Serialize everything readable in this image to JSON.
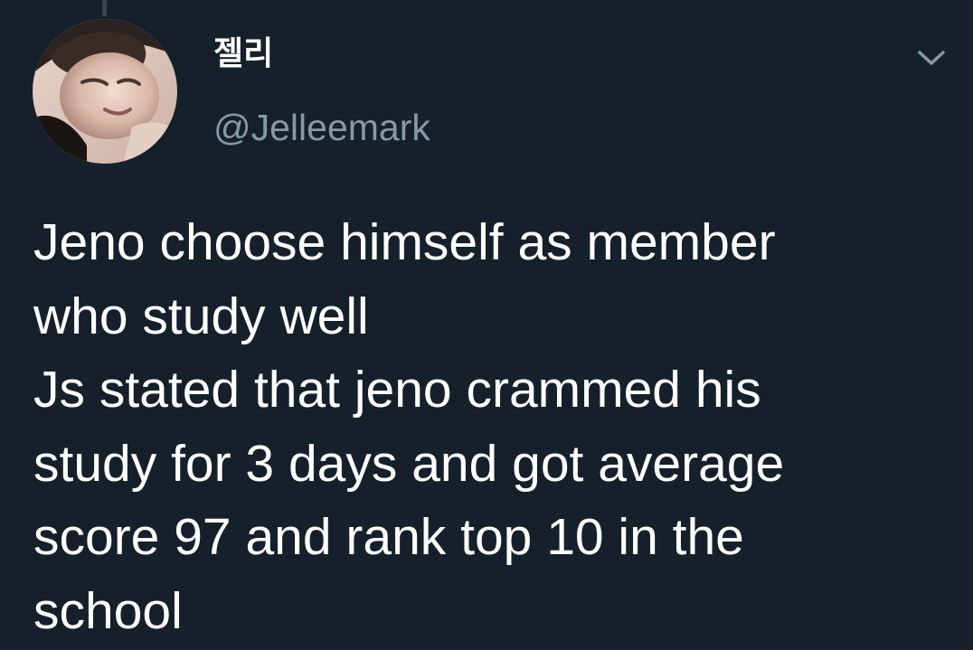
{
  "author": {
    "display_name": "젤리",
    "handle": "@Jelleemark"
  },
  "tweet": {
    "lines": [
      "Jeno choose himself as member",
      "who study well",
      "Js stated that jeno crammed his",
      "study for 3 days and got average",
      "score 97 and rank top 10 in the",
      "school"
    ]
  },
  "icons": {
    "menu": "chevron-down-icon",
    "avatar": "avatar-photo"
  },
  "colors": {
    "background": "#15202b",
    "primary_text": "#ffffff",
    "secondary_text": "#8899a6",
    "thread_line": "#38444d"
  }
}
